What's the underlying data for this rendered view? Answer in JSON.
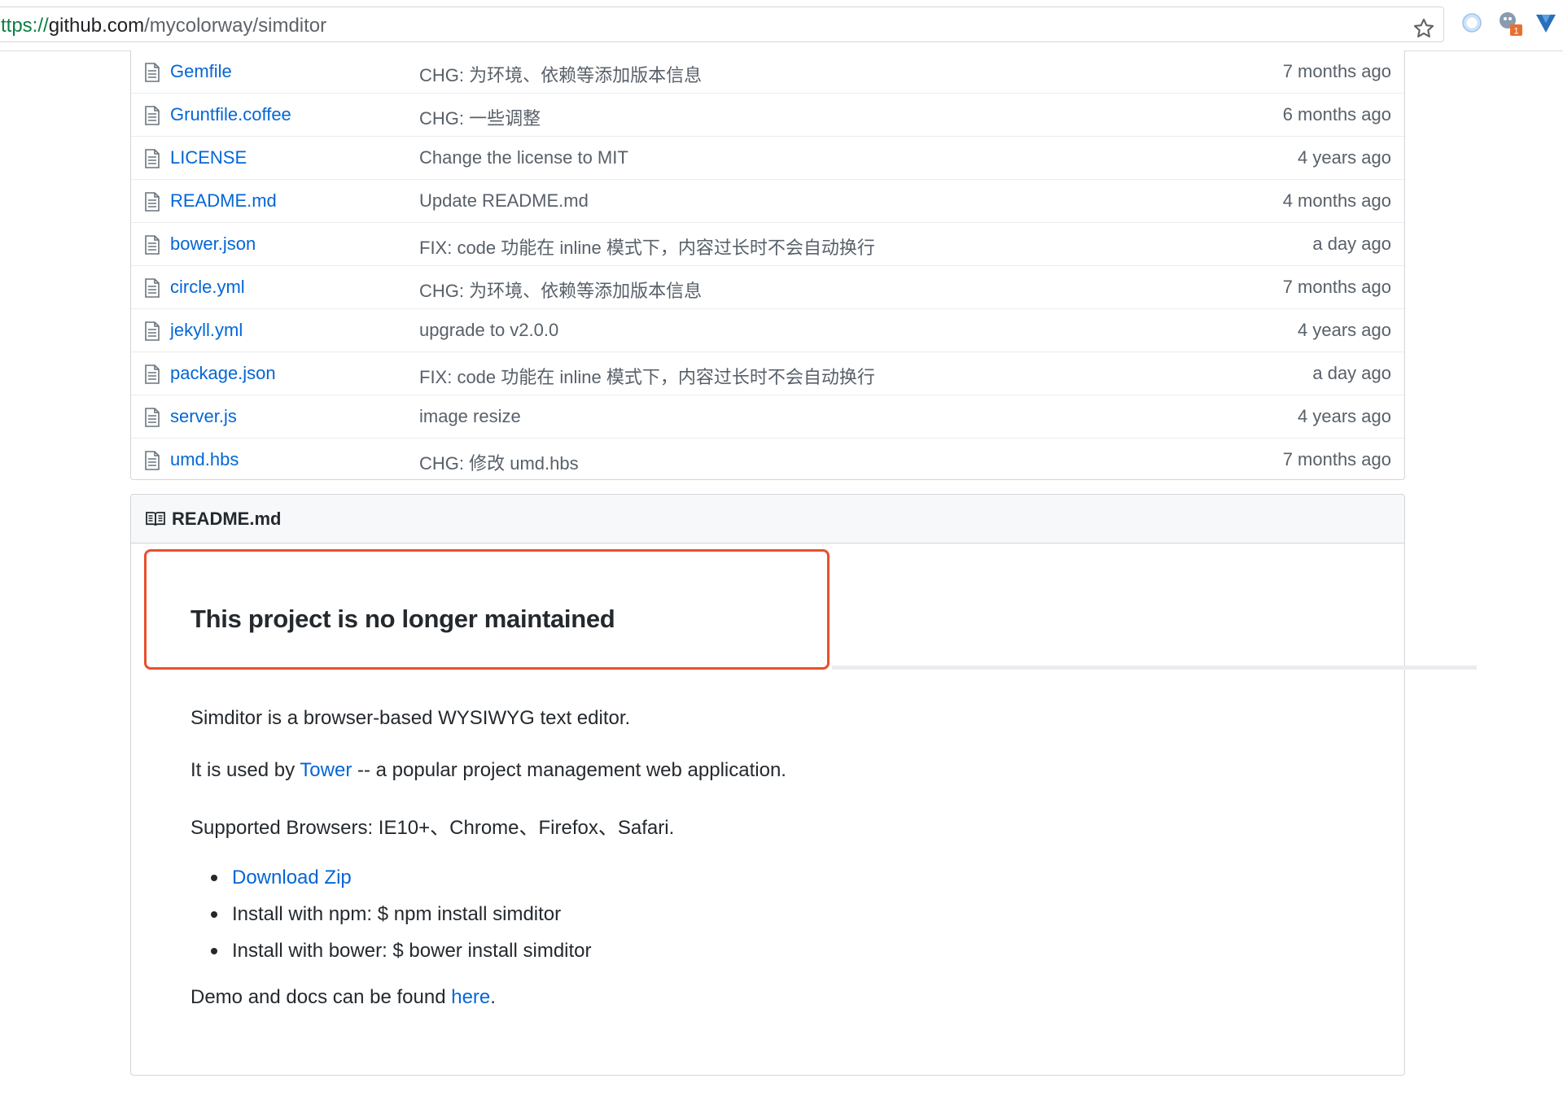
{
  "browser": {
    "url_scheme": "ttps://",
    "url_host": "github.com",
    "url_path": "/mycolorway/simditor",
    "extension_badge": "1"
  },
  "files": [
    {
      "name": "Gemfile",
      "message": "CHG: 为环境、依赖等添加版本信息",
      "age": "7 months ago"
    },
    {
      "name": "Gruntfile.coffee",
      "message": "CHG: 一些调整",
      "age": "6 months ago"
    },
    {
      "name": "LICENSE",
      "message": "Change the license to MIT",
      "age": "4 years ago"
    },
    {
      "name": "README.md",
      "message": "Update README.md",
      "age": "4 months ago"
    },
    {
      "name": "bower.json",
      "message": "FIX: code 功能在 inline 模式下，内容过长时不会自动换行",
      "age": "a day ago"
    },
    {
      "name": "circle.yml",
      "message": "CHG: 为环境、依赖等添加版本信息",
      "age": "7 months ago"
    },
    {
      "name": "jekyll.yml",
      "message": "upgrade to v2.0.0",
      "age": "4 years ago"
    },
    {
      "name": "package.json",
      "message": "FIX: code 功能在 inline 模式下，内容过长时不会自动换行",
      "age": "a day ago"
    },
    {
      "name": "server.js",
      "message": "image resize",
      "age": "4 years ago"
    },
    {
      "name": "umd.hbs",
      "message": "CHG: 修改 umd.hbs",
      "age": "7 months ago"
    }
  ],
  "readme": {
    "title": "README.md",
    "notice": "This project is no longer maintained",
    "intro": "Simditor is a browser-based WYSIWYG text editor.",
    "used_by_prefix": "It is used by ",
    "used_by_link": "Tower",
    "used_by_suffix": " -- a popular project management web application.",
    "browsers": "Supported Browsers: IE10+、Chrome、Firefox、Safari.",
    "bullets": {
      "download": "Download Zip",
      "npm": "Install with npm: $ npm install simditor",
      "bower": "Install with bower: $ bower install simditor"
    },
    "demo_prefix": "Demo and docs can be found ",
    "demo_link": "here",
    "demo_suffix": "."
  },
  "colors": {
    "link": "#0366d6",
    "muted": "#586069",
    "highlight": "#e8502e"
  }
}
